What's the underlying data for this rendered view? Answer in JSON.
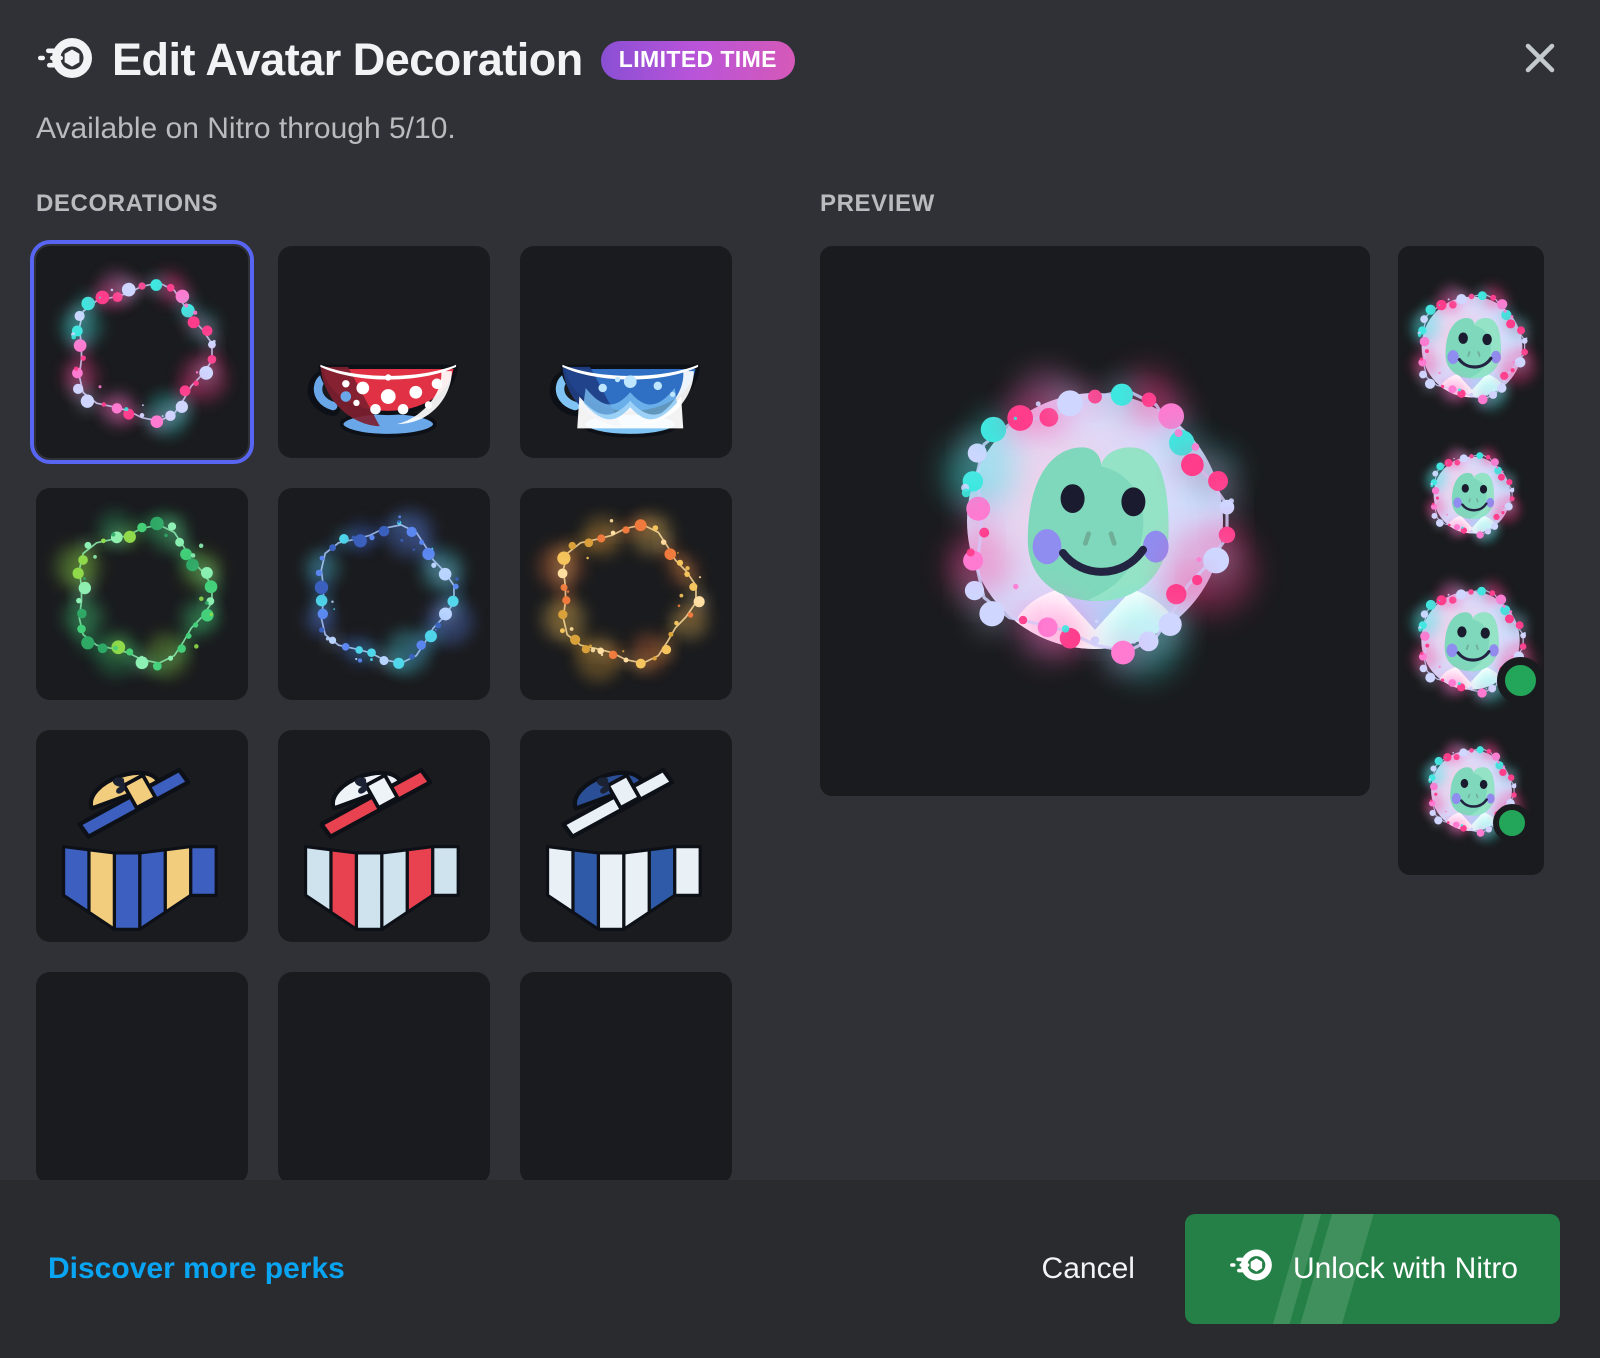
{
  "header": {
    "icon": "nitro-wheel-icon",
    "title": "Edit Avatar Decoration",
    "badge": "LIMITED TIME",
    "subtitle": "Available on Nitro through 5/10.",
    "close_icon": "close-icon"
  },
  "sections": {
    "decorations_label": "DECORATIONS",
    "preview_label": "PREVIEW"
  },
  "decorations": [
    {
      "name": "string-lights-pink-cyan",
      "type": "wreath",
      "selected": true,
      "colors": {
        "a": "#ff3d8b",
        "b": "#3ee8e0",
        "c": "#ff7ad1",
        "line": "#cfd6ff"
      }
    },
    {
      "name": "teacup-red-polkadot",
      "type": "teacup",
      "selected": false,
      "colors": {
        "body": "#e03244",
        "dark": "#7d2030",
        "accent": "#6aa7e8",
        "rim": "#ffffff"
      }
    },
    {
      "name": "teacup-blue-scallop",
      "type": "teacup",
      "selected": false,
      "colors": {
        "body": "#2f6fc4",
        "dark": "#1f3f86",
        "accent": "#7fc4f5",
        "rim": "#ffffff"
      }
    },
    {
      "name": "string-lights-green",
      "type": "wreath",
      "selected": false,
      "colors": {
        "a": "#44d07a",
        "b": "#8fd94a",
        "c": "#2fa866",
        "line": "#8ef0b4"
      }
    },
    {
      "name": "string-lights-blue",
      "type": "wreath",
      "selected": false,
      "colors": {
        "a": "#5b86f0",
        "b": "#4fd7ea",
        "c": "#3a5fbd",
        "line": "#b9d4ff"
      }
    },
    {
      "name": "string-lights-gold",
      "type": "wreath",
      "selected": false,
      "colors": {
        "a": "#f6c45c",
        "b": "#f07a3d",
        "c": "#d9a13a",
        "line": "#ffdfa3"
      }
    },
    {
      "name": "sailor-hat-gold",
      "type": "sailor",
      "selected": false,
      "colors": {
        "hat": "#f3cd7e",
        "band": "#3c5fc0",
        "stripe1": "#f3cd7e",
        "stripe2": "#3c5fc0"
      }
    },
    {
      "name": "sailor-hat-red",
      "type": "sailor",
      "selected": false,
      "colors": {
        "hat": "#eef3f7",
        "band": "#e8414f",
        "stripe1": "#e8414f",
        "stripe2": "#cfe3ef"
      }
    },
    {
      "name": "sailor-hat-blue",
      "type": "sailor",
      "selected": false,
      "colors": {
        "hat": "#2a4f96",
        "band": "#e9f1f6",
        "stripe1": "#2f5aa8",
        "stripe2": "#e9f1f6"
      }
    },
    {
      "name": "decoration-placeholder-1",
      "type": "empty",
      "selected": false,
      "colors": {}
    },
    {
      "name": "decoration-placeholder-2",
      "type": "empty",
      "selected": false,
      "colors": {}
    },
    {
      "name": "decoration-placeholder-3",
      "type": "empty",
      "selected": false,
      "colors": {}
    }
  ],
  "preview": {
    "avatar_name": "frog-avatar",
    "avatar_colors": {
      "skin": "#7fd8bb",
      "skin_light": "#a8edd2",
      "bg1": "#d7dcfb",
      "bg2": "#f3cfe8",
      "cheek": "#8f8df0",
      "shirt": "#ffffff"
    },
    "main_size": 330,
    "thumbnails": [
      {
        "name": "preview-thumb-large",
        "size": 120,
        "status": null
      },
      {
        "name": "preview-thumb-medium",
        "size": 92,
        "status": null
      },
      {
        "name": "preview-thumb-large-online",
        "size": 118,
        "status": "online"
      },
      {
        "name": "preview-thumb-small-online",
        "size": 96,
        "status": "online"
      }
    ],
    "status_color": "#23a55a"
  },
  "footer": {
    "perks_link": "Discover more perks",
    "cancel_label": "Cancel",
    "unlock_label": "Unlock with Nitro",
    "unlock_icon": "nitro-wheel-icon",
    "unlock_color": "#248046",
    "link_color": "#09a5f2"
  }
}
